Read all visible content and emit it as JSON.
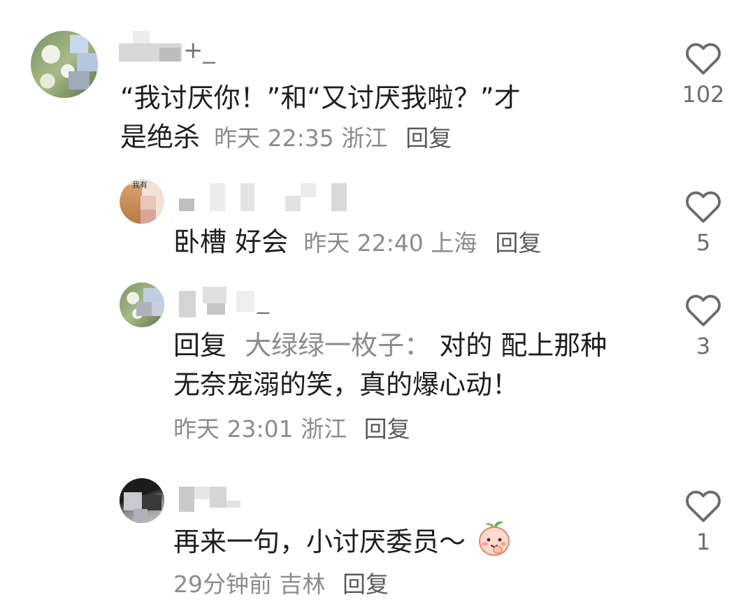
{
  "comments": [
    {
      "text_line1": "“我讨厌你！”和“又讨厌我啦？”才",
      "text_line2": "是绝杀",
      "meta": "昨天 22:35 浙江",
      "reply": "回复",
      "likes": "102",
      "name_fragment": "+_"
    },
    {
      "text": "卧槽 好会",
      "meta": "昨天 22:40 上海",
      "reply": "回复",
      "likes": "5",
      "avatar_text": "我有"
    },
    {
      "reply_prefix": "回复",
      "mention": "大绿绿一枚子：",
      "text_line1": "对的 配上那种",
      "text_line2": "无奈宠溺的笑，真的爆心动！",
      "meta": "昨天 23:01 浙江",
      "reply": "回复",
      "likes": "3",
      "name_fragment": "_"
    },
    {
      "text": "再来一句，小讨厌委员～",
      "meta": "29分钟前 吉林",
      "reply": "回复",
      "likes": "1"
    }
  ],
  "colors": {
    "like_icon": "#6b6b6b",
    "meta": "#8c8c8c"
  },
  "icons": {
    "like": "heart-outline-icon",
    "emoji": "peach-face-emoji"
  }
}
